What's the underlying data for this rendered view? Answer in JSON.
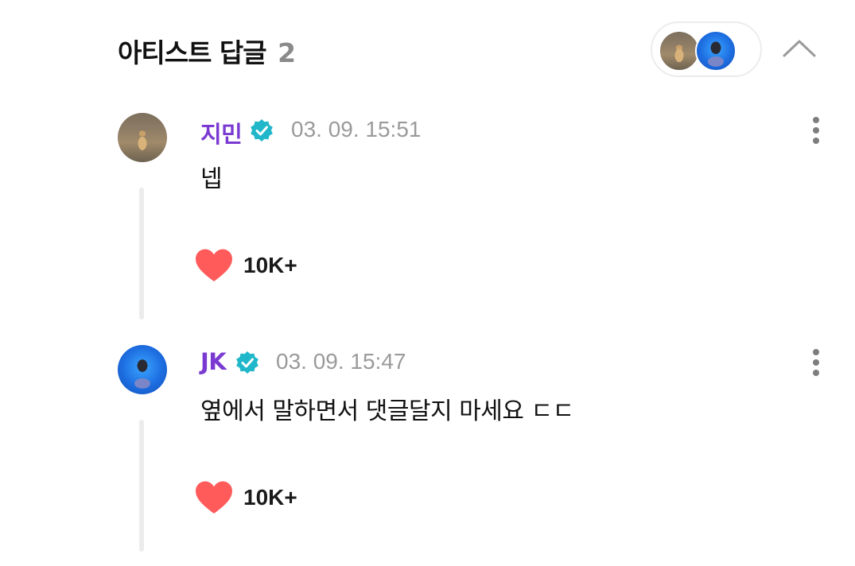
{
  "header": {
    "title": "아티스트 답글",
    "count": "2"
  },
  "comments": [
    {
      "author": "지민",
      "timestamp": "03. 09. 15:51",
      "text": "넵",
      "likes": "10K+"
    },
    {
      "author": "JK",
      "timestamp": "03. 09. 15:47",
      "text": "옆에서 말하면서 댓글달지 마세요 ㄷㄷ",
      "likes": "10K+"
    }
  ],
  "colors": {
    "author": "#7a3ad2",
    "verified_badge": "#1fb7c9",
    "heart": "#ff5b5b",
    "timestamp": "#9a9a9a"
  },
  "icons": {
    "collapse": "chevron-up-icon",
    "verified": "verified-badge-icon",
    "more": "more-vertical-icon",
    "like": "heart-icon"
  }
}
